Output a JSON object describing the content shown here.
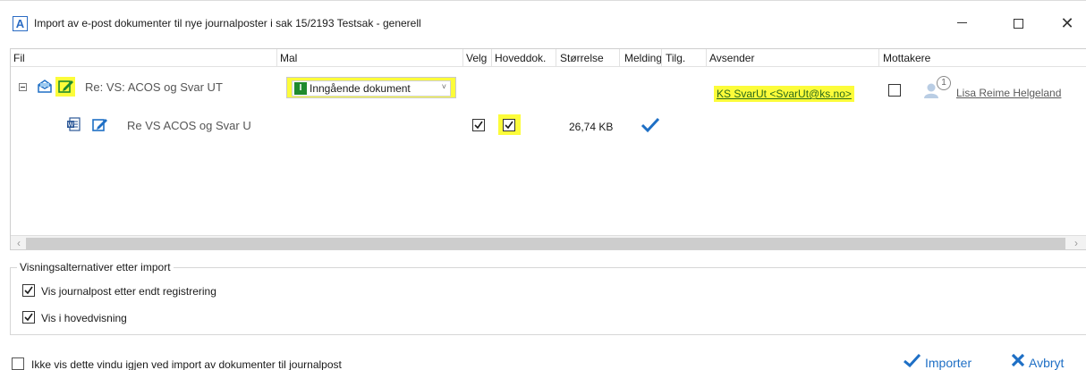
{
  "window": {
    "app_icon": "A",
    "title": "Import av e-post dokumenter til nye journalposter i sak 15/2193 Testsak - generell",
    "minimize_icon": "minimize-icon",
    "maximize_icon": "maximize-icon",
    "close_glyph": "✕"
  },
  "grid": {
    "columns": [
      "Fil",
      "Mal",
      "Velg",
      "Hoveddok.",
      "Størrelse",
      "Melding",
      "Tilg.",
      "Avsender",
      "Mottakere"
    ],
    "email_row": {
      "subject": "Re: VS: ACOS og Svar UT",
      "template": "Inngående dokument",
      "template_icon_letter": "I",
      "sender": "KS SvarUt <SvarUt@ks.no>",
      "recipient_badge": "1",
      "recipient": "Lisa Reime Helgeland",
      "highlight_color": "#fcfc3a"
    },
    "file_row": {
      "name": "Re VS ACOS og Svar U",
      "size": "26,74 KB",
      "velg_checked": true,
      "hoveddok_checked": true
    }
  },
  "options": {
    "legend": "Visningsalternativer etter import",
    "items": [
      {
        "label": "Vis journalpost etter endt registrering",
        "checked": true
      },
      {
        "label": "Vis i hovedvisning",
        "checked": true
      }
    ]
  },
  "footer": {
    "dont_show_label": "Ikke vis dette vindu igjen ved import av dokumenter til journalpost",
    "import_label": "Importer",
    "cancel_label": "Avbryt",
    "accent_color": "#1e6fc5"
  }
}
